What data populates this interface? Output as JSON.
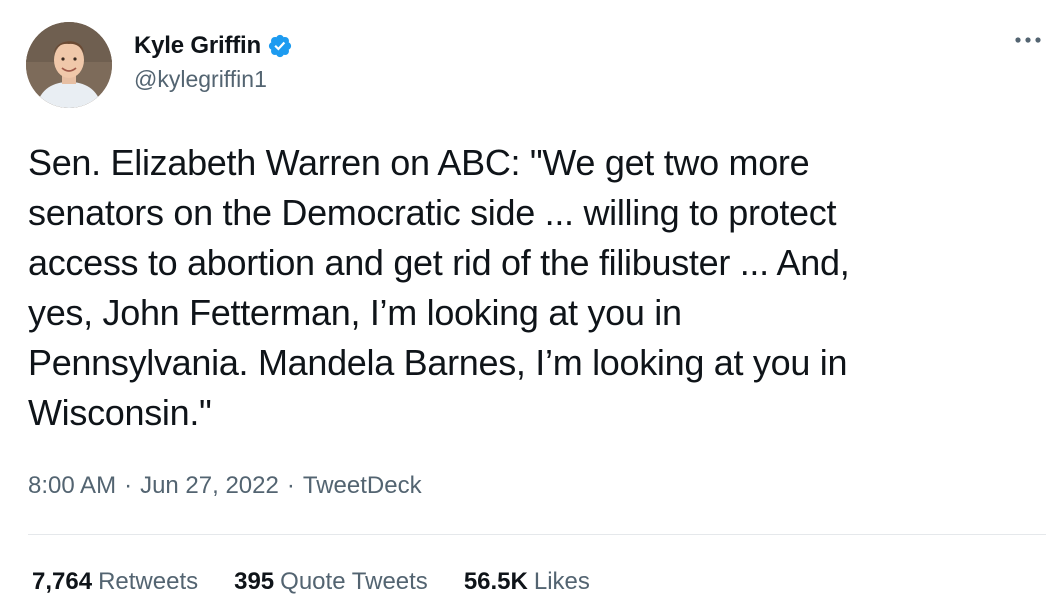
{
  "author": {
    "display_name": "Kyle Griffin",
    "handle": "@kylegriffin1",
    "verified": true,
    "avatar_icon": "profile-photo"
  },
  "menu": {
    "icon": "more-horizontal-icon"
  },
  "tweet": {
    "text": "Sen. Elizabeth Warren on ABC: \"We get two more\nsenators on the Democratic side ... willing to protect\naccess to abortion and get rid of the filibuster ... And,\nyes, John Fetterman, I’m looking at you in\nPennsylvania. Mandela Barnes, I’m looking at you in\nWisconsin.\""
  },
  "meta": {
    "time": "8:00 AM",
    "separator": "·",
    "date": "Jun 27, 2022",
    "source": "TweetDeck"
  },
  "stats": [
    {
      "count": "7,764",
      "label": "Retweets"
    },
    {
      "count": "395",
      "label": "Quote Tweets"
    },
    {
      "count": "56.5K",
      "label": "Likes"
    }
  ],
  "colors": {
    "text_primary": "#0f1419",
    "text_secondary": "#536471",
    "verified_blue": "#1d9bf0",
    "divider": "#e5e8eb"
  }
}
